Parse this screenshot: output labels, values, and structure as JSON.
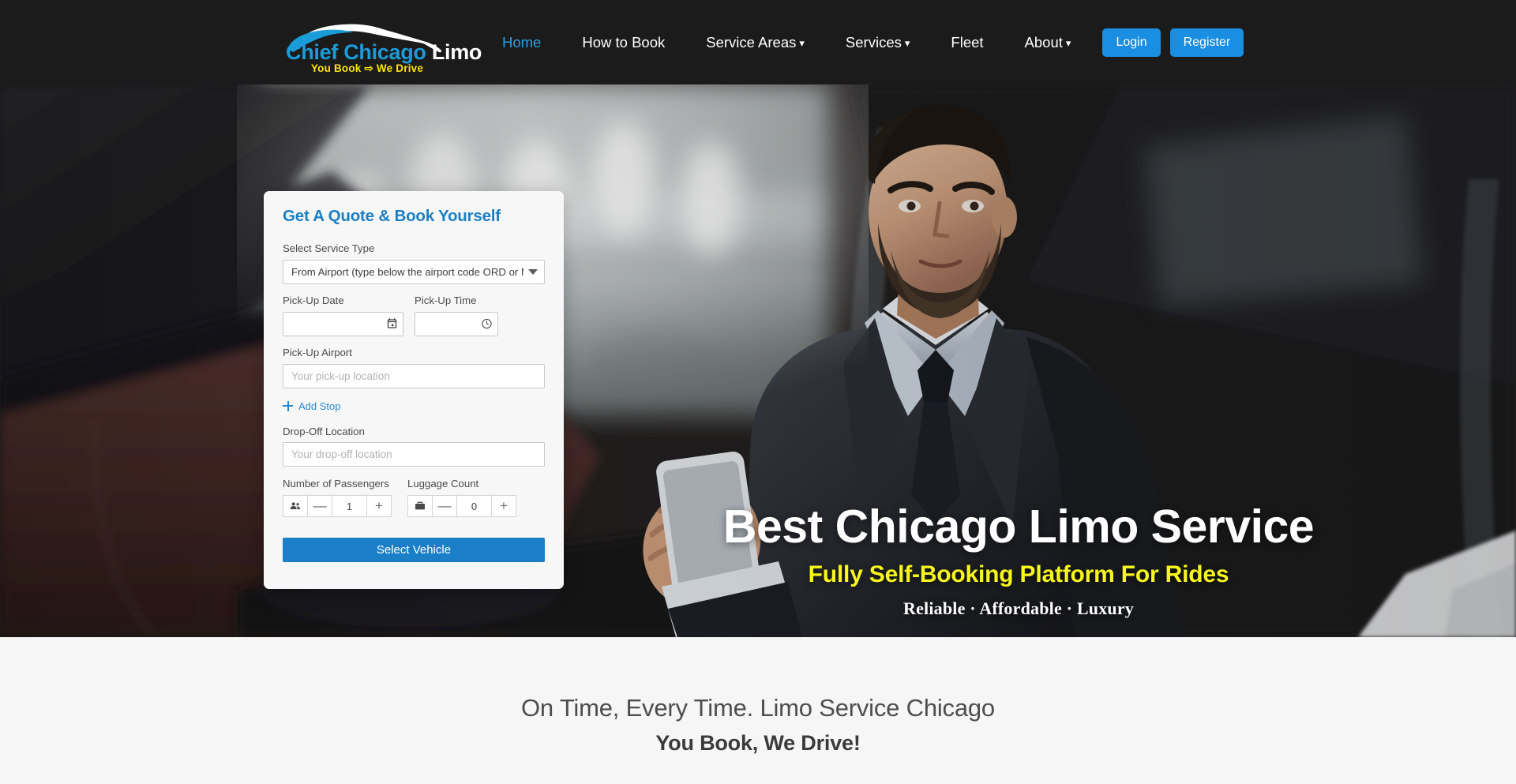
{
  "brand": {
    "logo_line1_part1": "Chief ",
    "logo_line1_part2": "Chicago ",
    "logo_line1_part3": "Limo",
    "logo_line2": "You Book ⇨ We Drive",
    "accent_blue": "#1a9cd8",
    "accent_yellow": "#ffe500"
  },
  "nav": {
    "items": [
      {
        "label": "Home",
        "active": true,
        "has_caret": false
      },
      {
        "label": "How to Book",
        "active": false,
        "has_caret": false
      },
      {
        "label": "Service Areas",
        "active": false,
        "has_caret": true
      },
      {
        "label": "Services",
        "active": false,
        "has_caret": true
      },
      {
        "label": "Fleet",
        "active": false,
        "has_caret": false
      },
      {
        "label": "About",
        "active": false,
        "has_caret": true
      }
    ],
    "login_label": "Login",
    "register_label": "Register",
    "button_color": "#1a8ee0",
    "active_color": "#2b9fe0",
    "bar_color": "#1b1b1b"
  },
  "hero": {
    "title": "Best Chicago Limo Service",
    "subtitle": "Fully Self-Booking Platform For Rides",
    "tagline": "Reliable · Affordable · Luxury",
    "subtitle_color": "#f7f71d",
    "title_color": "#ffffff"
  },
  "booking": {
    "title": "Get A Quote & Book Yourself",
    "title_color": "#1b7fc4",
    "service_type": {
      "label": "Select Service Type",
      "value": "From Airport (type below the airport code ORD or M",
      "icon": "chevron-down-icon"
    },
    "pickup_date": {
      "label": "Pick-Up Date",
      "value": "",
      "placeholder": "",
      "icon": "calendar-icon"
    },
    "pickup_time": {
      "label": "Pick-Up Time",
      "value": "",
      "placeholder": "",
      "icon": "clock-icon"
    },
    "pickup_airport": {
      "label": "Pick-Up Airport",
      "value": "",
      "placeholder": "Your pick-up location"
    },
    "add_stop": {
      "label": "Add Stop",
      "icon": "plus-icon"
    },
    "dropoff": {
      "label": "Drop-Off Location",
      "value": "",
      "placeholder": "Your drop-off location"
    },
    "passengers": {
      "label": "Number of Passengers",
      "icon": "people-icon",
      "decrement": "—",
      "value": "1",
      "increment": "+"
    },
    "luggage": {
      "label": "Luggage Count",
      "icon": "briefcase-icon",
      "decrement": "—",
      "value": "0",
      "increment": "+"
    },
    "submit_label": "Select Vehicle",
    "submit_color": "#1a7fc6"
  },
  "below_hero": {
    "heading": "On Time, Every Time. Limo Service Chicago",
    "subheading": "You Book, We Drive!"
  }
}
